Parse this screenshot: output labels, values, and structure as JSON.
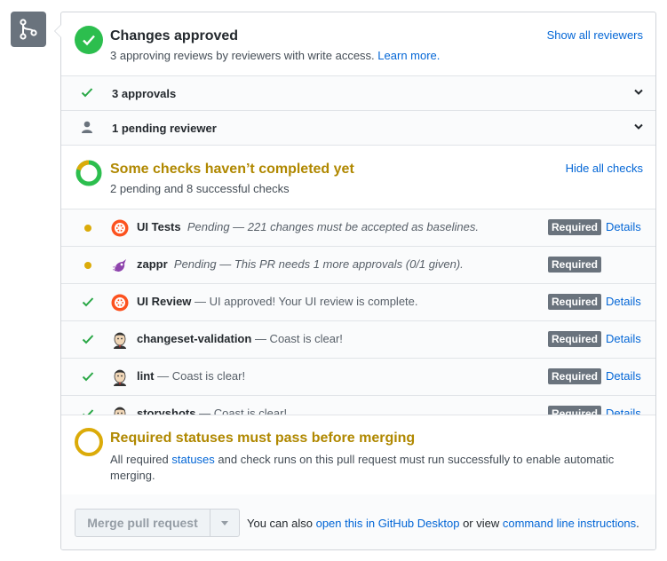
{
  "review": {
    "title": "Changes approved",
    "subtitle": "3 approving reviews by reviewers with write access.",
    "learn_more": "Learn more.",
    "show_all_link": "Show all reviewers",
    "approvals_label": "3 approvals",
    "pending_label": "1 pending reviewer"
  },
  "checks_summary": {
    "title": "Some checks haven’t completed yet",
    "subtitle": "2 pending and 8 successful checks",
    "hide_all_link": "Hide all checks"
  },
  "checks": [
    {
      "status": "pending",
      "icon": "chromatic-icon",
      "name": "UI Tests",
      "description": "Pending — 221 changes must be accepted as baselines.",
      "badge": "Required",
      "details": "Details"
    },
    {
      "status": "pending",
      "icon": "zappr-icon",
      "name": "zappr",
      "description": "Pending — This PR needs 1 more approvals (0/1 given).",
      "badge": "Required",
      "details": ""
    },
    {
      "status": "success",
      "icon": "chromatic-icon",
      "name": "UI Review",
      "description": "— UI approved! Your UI review is complete.",
      "badge": "Required",
      "details": "Details"
    },
    {
      "status": "success",
      "icon": "jenkins-icon",
      "name": "changeset-validation",
      "description": "— Coast is clear!",
      "badge": "Required",
      "details": "Details"
    },
    {
      "status": "success",
      "icon": "jenkins-icon",
      "name": "lint",
      "description": "— Coast is clear!",
      "badge": "Required",
      "details": "Details"
    },
    {
      "status": "success",
      "icon": "jenkins-icon",
      "name": "storyshots",
      "description": "— Coast is clear!",
      "badge": "Required",
      "details": "Details"
    }
  ],
  "merge_requirement": {
    "title": "Required statuses must pass before merging",
    "body_pre": "All required ",
    "body_link": "statuses",
    "body_post": " and check runs on this pull request must run successfully to enable automatic merging."
  },
  "footer": {
    "merge_button": "Merge pull request",
    "text_pre": "You can also ",
    "desktop_link": "open this in GitHub Desktop",
    "text_mid": " or view ",
    "cli_link": "command line instructions",
    "text_post": "."
  },
  "colors": {
    "success": "#28a745",
    "pending": "#dbab09",
    "link": "#0366d6",
    "badge": "#6a737d"
  }
}
